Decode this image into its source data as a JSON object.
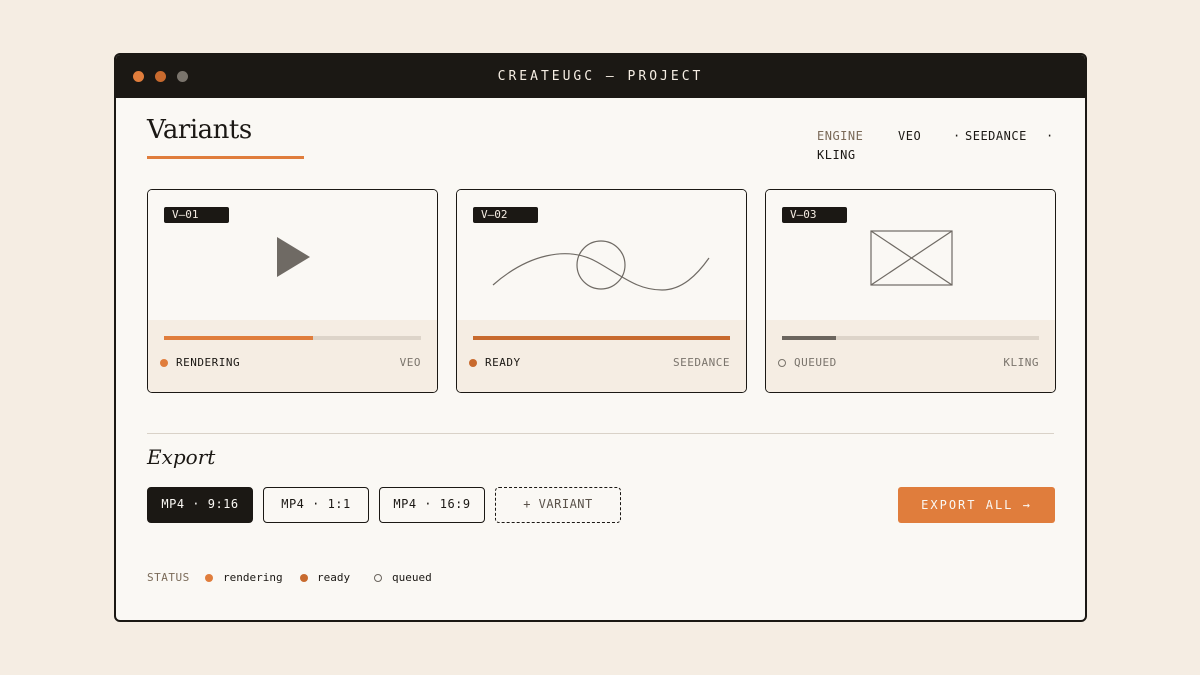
{
  "window": {
    "title": "CREATEUGC — PROJECT"
  },
  "page": {
    "title": "Variants"
  },
  "engines": {
    "label": "ENGINE",
    "items": [
      "VEO",
      "SEEDANCE",
      "KLING"
    ],
    "separator": "·"
  },
  "variants": [
    {
      "id": "V—01",
      "status": "RENDERING",
      "engine": "VEO",
      "progress": 0.58,
      "color": "#e07d3c",
      "icon": "play-icon"
    },
    {
      "id": "V—02",
      "status": "READY",
      "engine": "SEEDANCE",
      "progress": 1.0,
      "color": "#c86a2e",
      "icon": "motion-curve-icon"
    },
    {
      "id": "V—03",
      "status": "QUEUED",
      "engine": "KLING",
      "progress": 0.21,
      "color": "#6b655e",
      "icon": "image-placeholder-icon"
    }
  ],
  "export": {
    "title": "Export",
    "formats": [
      "MP4 · 9:16",
      "MP4 · 1:1",
      "MP4 · 16:9"
    ],
    "add_variant": "+ VARIANT",
    "export_all": "EXPORT ALL →"
  },
  "legend": {
    "label": "STATUS",
    "items": [
      {
        "label": "rendering",
        "color": "#e07d3c"
      },
      {
        "label": "ready",
        "color": "#c86a2e"
      },
      {
        "label": "queued",
        "color": "#6b655e"
      }
    ]
  }
}
